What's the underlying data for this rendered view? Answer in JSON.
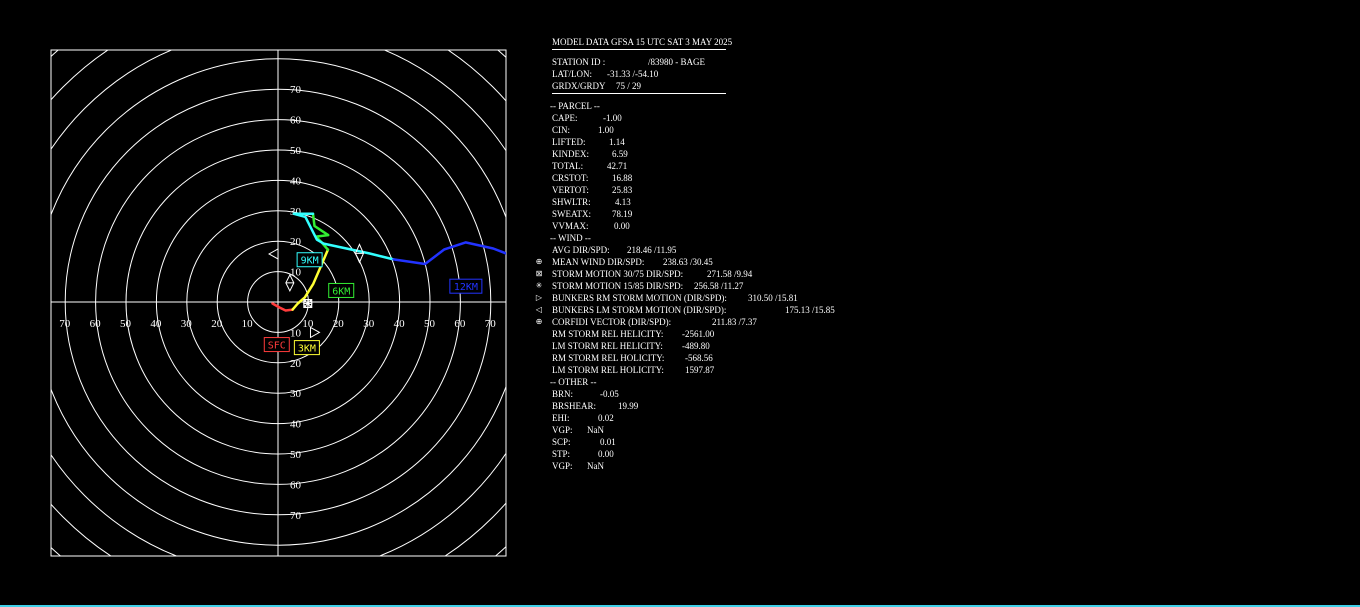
{
  "chart_data": {
    "type": "hodograph",
    "range_kt": 75,
    "ring_labels": [
      10,
      20,
      30,
      40,
      50,
      60,
      70
    ],
    "segments": [
      {
        "color": "#ff3b3b",
        "points": [
          [
            -1.8,
            -0.5
          ],
          [
            0.5,
            -1.8
          ],
          [
            2.5,
            -2.8
          ],
          [
            4.8,
            -2.5
          ]
        ]
      },
      {
        "color": "#ffff33",
        "points": [
          [
            4.8,
            -2.5
          ],
          [
            6.5,
            -0.5
          ],
          [
            8.8,
            1.5
          ],
          [
            11.6,
            6.0
          ],
          [
            14.2,
            12.0
          ],
          [
            16.4,
            17.2
          ]
        ]
      },
      {
        "color": "#33ee33",
        "points": [
          [
            16.4,
            17.2
          ],
          [
            14.0,
            20.0
          ],
          [
            12.5,
            21.5
          ],
          [
            16.5,
            22.0
          ],
          [
            12.0,
            25.0
          ],
          [
            11.5,
            29.0
          ]
        ]
      },
      {
        "color": "#33ffff",
        "points": [
          [
            11.5,
            29.0
          ],
          [
            5.2,
            29.0
          ],
          [
            9.0,
            28.0
          ],
          [
            12.8,
            20.5
          ],
          [
            15.0,
            19.2
          ],
          [
            30.0,
            16.0
          ],
          [
            38.0,
            14.0
          ]
        ]
      },
      {
        "color": "#2233ff",
        "points": [
          [
            38.0,
            14.0
          ],
          [
            48.4,
            12.5
          ],
          [
            54.7,
            17.3
          ],
          [
            61.7,
            19.6
          ],
          [
            70.8,
            17.6
          ],
          [
            75.0,
            16.0
          ]
        ]
      }
    ],
    "height_labels": [
      {
        "text": "SFC",
        "color": "#ff3b3b",
        "at": [
          -0.4,
          -14.0
        ]
      },
      {
        "text": "3KM",
        "color": "#ffff33",
        "at": [
          9.5,
          -15.0
        ]
      },
      {
        "text": "6KM",
        "color": "#33ee33",
        "at": [
          20.8,
          3.8
        ]
      },
      {
        "text": "9KM",
        "color": "#33ffff",
        "at": [
          10.4,
          13.9
        ]
      },
      {
        "text": "12KM",
        "color": "#2233ff",
        "at": [
          61.8,
          5.2
        ]
      }
    ],
    "storm_markers": [
      {
        "name": "mean-wind",
        "u": 9.8,
        "v": -0.5
      },
      {
        "name": "storm-motion-30-75",
        "u": 9.8,
        "v": -0.5
      },
      {
        "name": "storm-motion-15-85",
        "u": 9.8,
        "v": -0.5
      },
      {
        "name": "bunkers-rm",
        "u": 12.0,
        "v": -10.0
      },
      {
        "name": "bunkers-lm",
        "u": -1.3,
        "v": 15.8
      },
      {
        "name": "corfidi",
        "u": 3.9,
        "v": 6.3
      }
    ],
    "marker_24kt": {
      "u": 26.8,
      "v": 16.0
    }
  },
  "header": {
    "title": "MODEL DATA GFSA 15 UTC SAT  3 MAY 2025",
    "station_label": "STATION ID :",
    "station_value": "/83980  - BAGE",
    "latlon_label": "LAT/LON:",
    "latlon_value": "-31.33 /-54.10",
    "grd_label": "GRDX/GRDY",
    "grd_value": "75 /   29"
  },
  "parcel": {
    "heading": "-- PARCEL --",
    "rows": [
      {
        "label": "CAPE:",
        "value": "-1.00"
      },
      {
        "label": "CIN:",
        "value": "1.00"
      },
      {
        "label": "LIFTED:",
        "value": "1.14"
      },
      {
        "label": "KINDEX:",
        "value": "6.59"
      },
      {
        "label": "TOTAL:",
        "value": "42.71"
      },
      {
        "label": "CRSTOT:",
        "value": "16.88"
      },
      {
        "label": "VERTOT:",
        "value": "25.83"
      },
      {
        "label": "SHWLTR:",
        "value": "4.13"
      },
      {
        "label": "SWEATX:",
        "value": "78.19"
      },
      {
        "label": "VVMAX:",
        "value": "0.00"
      }
    ]
  },
  "wind": {
    "heading": "-- WIND --",
    "rows": [
      {
        "label": "AVG DIR/SPD:",
        "value": "218.46 /11.95"
      },
      {
        "label": "MEAN WIND DIR/SPD:",
        "value": "238.63 /30.45"
      },
      {
        "label": "STORM MOTION 30/75 DIR/SPD:",
        "value": "271.58 /9.94"
      },
      {
        "label": "STORM MOTION 15/85 DIR/SPD:",
        "value": "256.58 /11.27"
      },
      {
        "label": "BUNKERS RM STORM MOTION (DIR/SPD):",
        "value": "310.50 /15.81"
      },
      {
        "label": "BUNKERS LM STORM MOTION (DIR/SPD):",
        "value": "175.13 /15.85"
      },
      {
        "label": "CORFIDI VECTOR (DIR/SPD):",
        "value": "211.83 /7.37"
      },
      {
        "label": "RM STORM REL HELICITY:",
        "value": "-2561.00"
      },
      {
        "label": "LM STORM REL HELICITY:",
        "value": "-489.80"
      },
      {
        "label": "RM STORM REL HOLICITY:",
        "value": "-568.56"
      },
      {
        "label": "LM STORM REL HOLICITY:",
        "value": "1597.87"
      }
    ]
  },
  "other": {
    "heading": "-- OTHER --",
    "rows": [
      {
        "label": "BRN:",
        "value": "-0.05"
      },
      {
        "label": "BRSHEAR:",
        "value": "19.99"
      },
      {
        "label": "EHI:",
        "value": "0.02"
      },
      {
        "label": "VGP:",
        "value": "NaN"
      },
      {
        "label": "SCP:",
        "value": "0.01"
      },
      {
        "label": "STP:",
        "value": "0.00"
      },
      {
        "label": "VGP:",
        "value": "NaN"
      }
    ]
  },
  "colors": {
    "background": "#000000",
    "grid": "#ffffff",
    "accent_bottom": "#3fd0e8"
  }
}
